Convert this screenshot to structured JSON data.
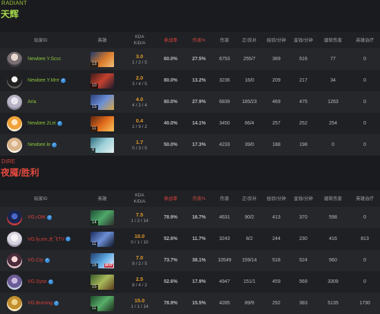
{
  "headers": [
    "玩家ID",
    "英雄",
    "KDA",
    "K/D/A",
    "参战率",
    "伤害%",
    "伤害",
    "正/反补",
    "经验/分钟",
    "金钱/分钟",
    "建筑伤害",
    "英雄治疗"
  ],
  "radiant": {
    "tag": "RADIANT",
    "name": "天辉",
    "players": [
      {
        "name": "Newbee.Y.Sccc",
        "verified": false,
        "hero_level": "13",
        "kda": "3.0",
        "kda_line": "1 / 2 / 5",
        "participation": "60.0%",
        "damage_pct": "27.5%",
        "damage": "6753",
        "lh_dn": "255/7",
        "xpm": "369",
        "gpm": "516",
        "building": "77",
        "heal": "0"
      },
      {
        "name": "Newbee.Y.Mrrr",
        "verified": true,
        "hero_level": "10",
        "kda": "2.0",
        "kda_line": "3 / 4 / 5",
        "participation": "80.0%",
        "damage_pct": "13.2%",
        "damage": "3236",
        "lh_dn": "16/0",
        "xpm": "209",
        "gpm": "217",
        "building": "34",
        "heal": "0"
      },
      {
        "name": "Aria",
        "verified": false,
        "hero_level": "15",
        "kda": "4.0",
        "kda_line": "4 / 2 / 4",
        "participation": "80.0%",
        "damage_pct": "27.9%",
        "damage": "6839",
        "lh_dn": "185/23",
        "xpm": "469",
        "gpm": "475",
        "building": "1263",
        "heal": "0"
      },
      {
        "name": "Newbee.2Lei",
        "verified": true,
        "hero_level": "11",
        "kda": "0.4",
        "kda_line": "2 / 9 / 2",
        "participation": "40.0%",
        "damage_pct": "14.1%",
        "damage": "3450",
        "lh_dn": "66/4",
        "xpm": "257",
        "gpm": "252",
        "building": "254",
        "heal": "0"
      },
      {
        "name": "Newbee.le",
        "verified": true,
        "hero_level": "9",
        "kda": "1.7",
        "kda_line": "0 / 3 / 5",
        "participation": "50.0%",
        "damage_pct": "17.3%",
        "damage": "4233",
        "lh_dn": "39/0",
        "xpm": "188",
        "gpm": "198",
        "building": "0",
        "heal": "0"
      }
    ]
  },
  "dire": {
    "tag": "DIRE",
    "name": "夜魇/胜利",
    "players": [
      {
        "name": "VG.rOtK",
        "verified": true,
        "hero_level": "14",
        "mvp": false,
        "kda": "7.5",
        "kda_line": "1 / 2 / 14",
        "participation": "78.9%",
        "damage_pct": "16.7%",
        "damage": "4631",
        "lh_dn": "90/2",
        "xpm": "413",
        "gpm": "370",
        "building": "598",
        "heal": "0"
      },
      {
        "name": "VG.fy.sm.大飞TV",
        "verified": true,
        "hero_level": "11",
        "mvp": false,
        "kda": "10.0",
        "kda_line": "0 / 1 / 10",
        "participation": "52.6%",
        "damage_pct": "11.7%",
        "damage": "3243",
        "lh_dn": "8/2",
        "xpm": "244",
        "gpm": "230",
        "building": "416",
        "heal": "813"
      },
      {
        "name": "VG.Cty",
        "verified": true,
        "hero_level": "16",
        "mvp": true,
        "mvp_label": "MVP",
        "kda": "7.0",
        "kda_line": "9 / 2 / 5",
        "participation": "73.7%",
        "damage_pct": "38.1%",
        "damage": "10549",
        "lh_dn": "159/14",
        "xpm": "518",
        "gpm": "524",
        "building": "560",
        "heal": "0"
      },
      {
        "name": "VG.Syso",
        "verified": true,
        "hero_level": "15",
        "mvp": false,
        "kda": "2.5",
        "kda_line": "8 / 4 / 2",
        "participation": "52.6%",
        "damage_pct": "17.9%",
        "damage": "4947",
        "lh_dn": "151/1",
        "xpm": "459",
        "gpm": "569",
        "building": "3309",
        "heal": "0"
      },
      {
        "name": "VG.Burning",
        "verified": true,
        "hero_level": "11",
        "mvp": false,
        "kda": "15.0",
        "kda_line": "1 / 1 / 14",
        "participation": "78.9%",
        "damage_pct": "15.5%",
        "damage": "4285",
        "lh_dn": "89/9",
        "xpm": "292",
        "gpm": "383",
        "building": "5135",
        "heal": "1730"
      }
    ]
  },
  "colors": {
    "radiant_accent": "#a8d94a",
    "dire_accent": "#e24a3f",
    "kda_ratio": "#e39a2a",
    "verified_badge": "#3b8fd9"
  }
}
